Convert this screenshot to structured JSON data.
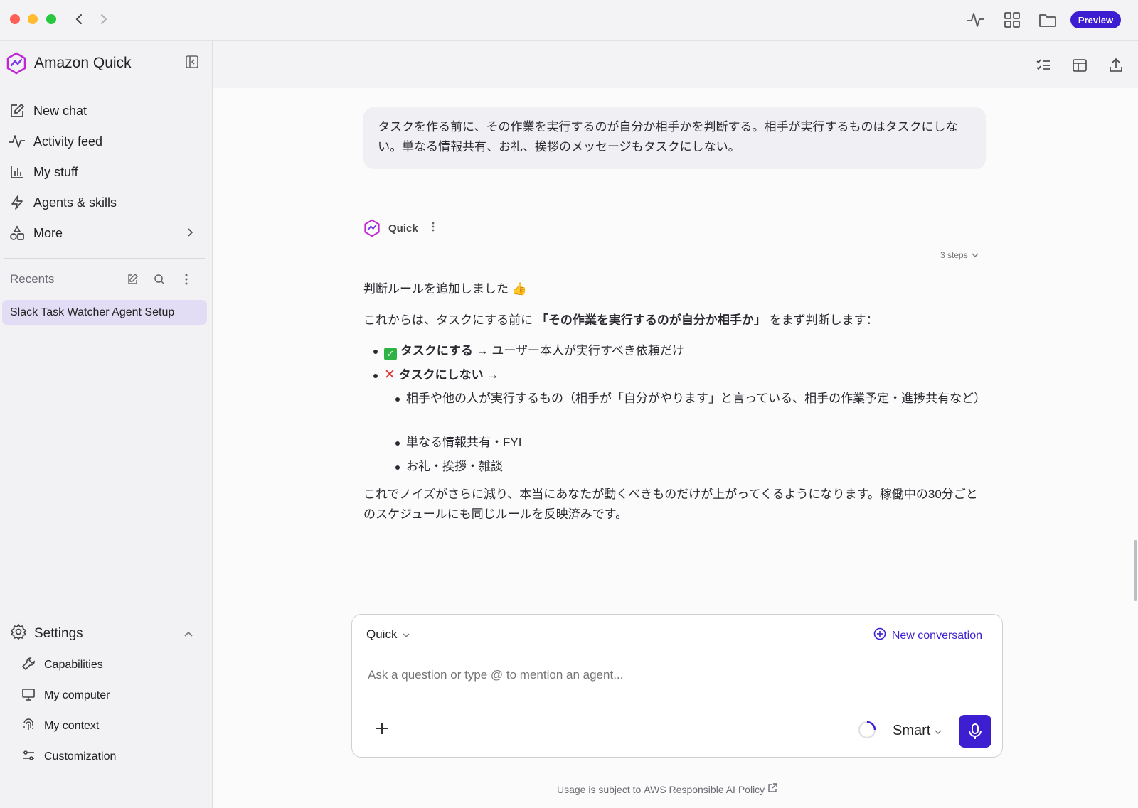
{
  "titlebar": {
    "preview_label": "Preview"
  },
  "sidebar": {
    "brand": "Amazon Quick",
    "nav": [
      {
        "label": "New chat"
      },
      {
        "label": "Activity feed"
      },
      {
        "label": "My stuff"
      },
      {
        "label": "Agents & skills"
      },
      {
        "label": "More"
      }
    ],
    "recents_label": "Recents",
    "recent_items": [
      "Slack Task Watcher Agent Setup"
    ],
    "settings_label": "Settings",
    "settings_items": [
      "Capabilities",
      "My computer",
      "My context",
      "Customization"
    ]
  },
  "chat": {
    "user_message": "タスクを作る前に、その作業を実行するのが自分か相手かを判断する。相手が実行するものはタスクにしない。単なる情報共有、お礼、挨拶のメッセージもタスクにしない。",
    "agent_name": "Quick",
    "steps": "3 steps",
    "reply_line1": "判断ルールを追加しました 👍",
    "reply_line2_pre": "これからは、タスクにする前に ",
    "reply_line2_bold": "「その作業を実行するのが自分か相手か」",
    "reply_line2_post": " をまず判断します：",
    "bullet1_bold": "タスクにする",
    "bullet1_rest": " → ユーザー本人が実行すべき依頼だけ",
    "bullet2_bold": "タスクにしない",
    "bullet2_rest": " →",
    "sub1": "相手や他の人が実行するもの（相手が「自分がやります」と言っている、相手の作業予定・進捗共有など）",
    "sub2": "単なる情報共有・FYI",
    "sub3": "お礼・挨拶・雑談",
    "closing": "これでノイズがさらに減り、本当にあなたが動くべきものだけが上がってくるようになります。稼働中の30分ごとのスケジュールにも同じルールを反映済みです。"
  },
  "composer": {
    "agent": "Quick",
    "new_conversation": "New conversation",
    "placeholder": "Ask a question or type @ to mention an agent...",
    "mode": "Smart"
  },
  "footer": {
    "prefix": "Usage is subject to",
    "link": "AWS Responsible AI Policy"
  },
  "colors": {
    "accent": "#3d1fd1",
    "recent_bg": "#e3dcf5"
  }
}
